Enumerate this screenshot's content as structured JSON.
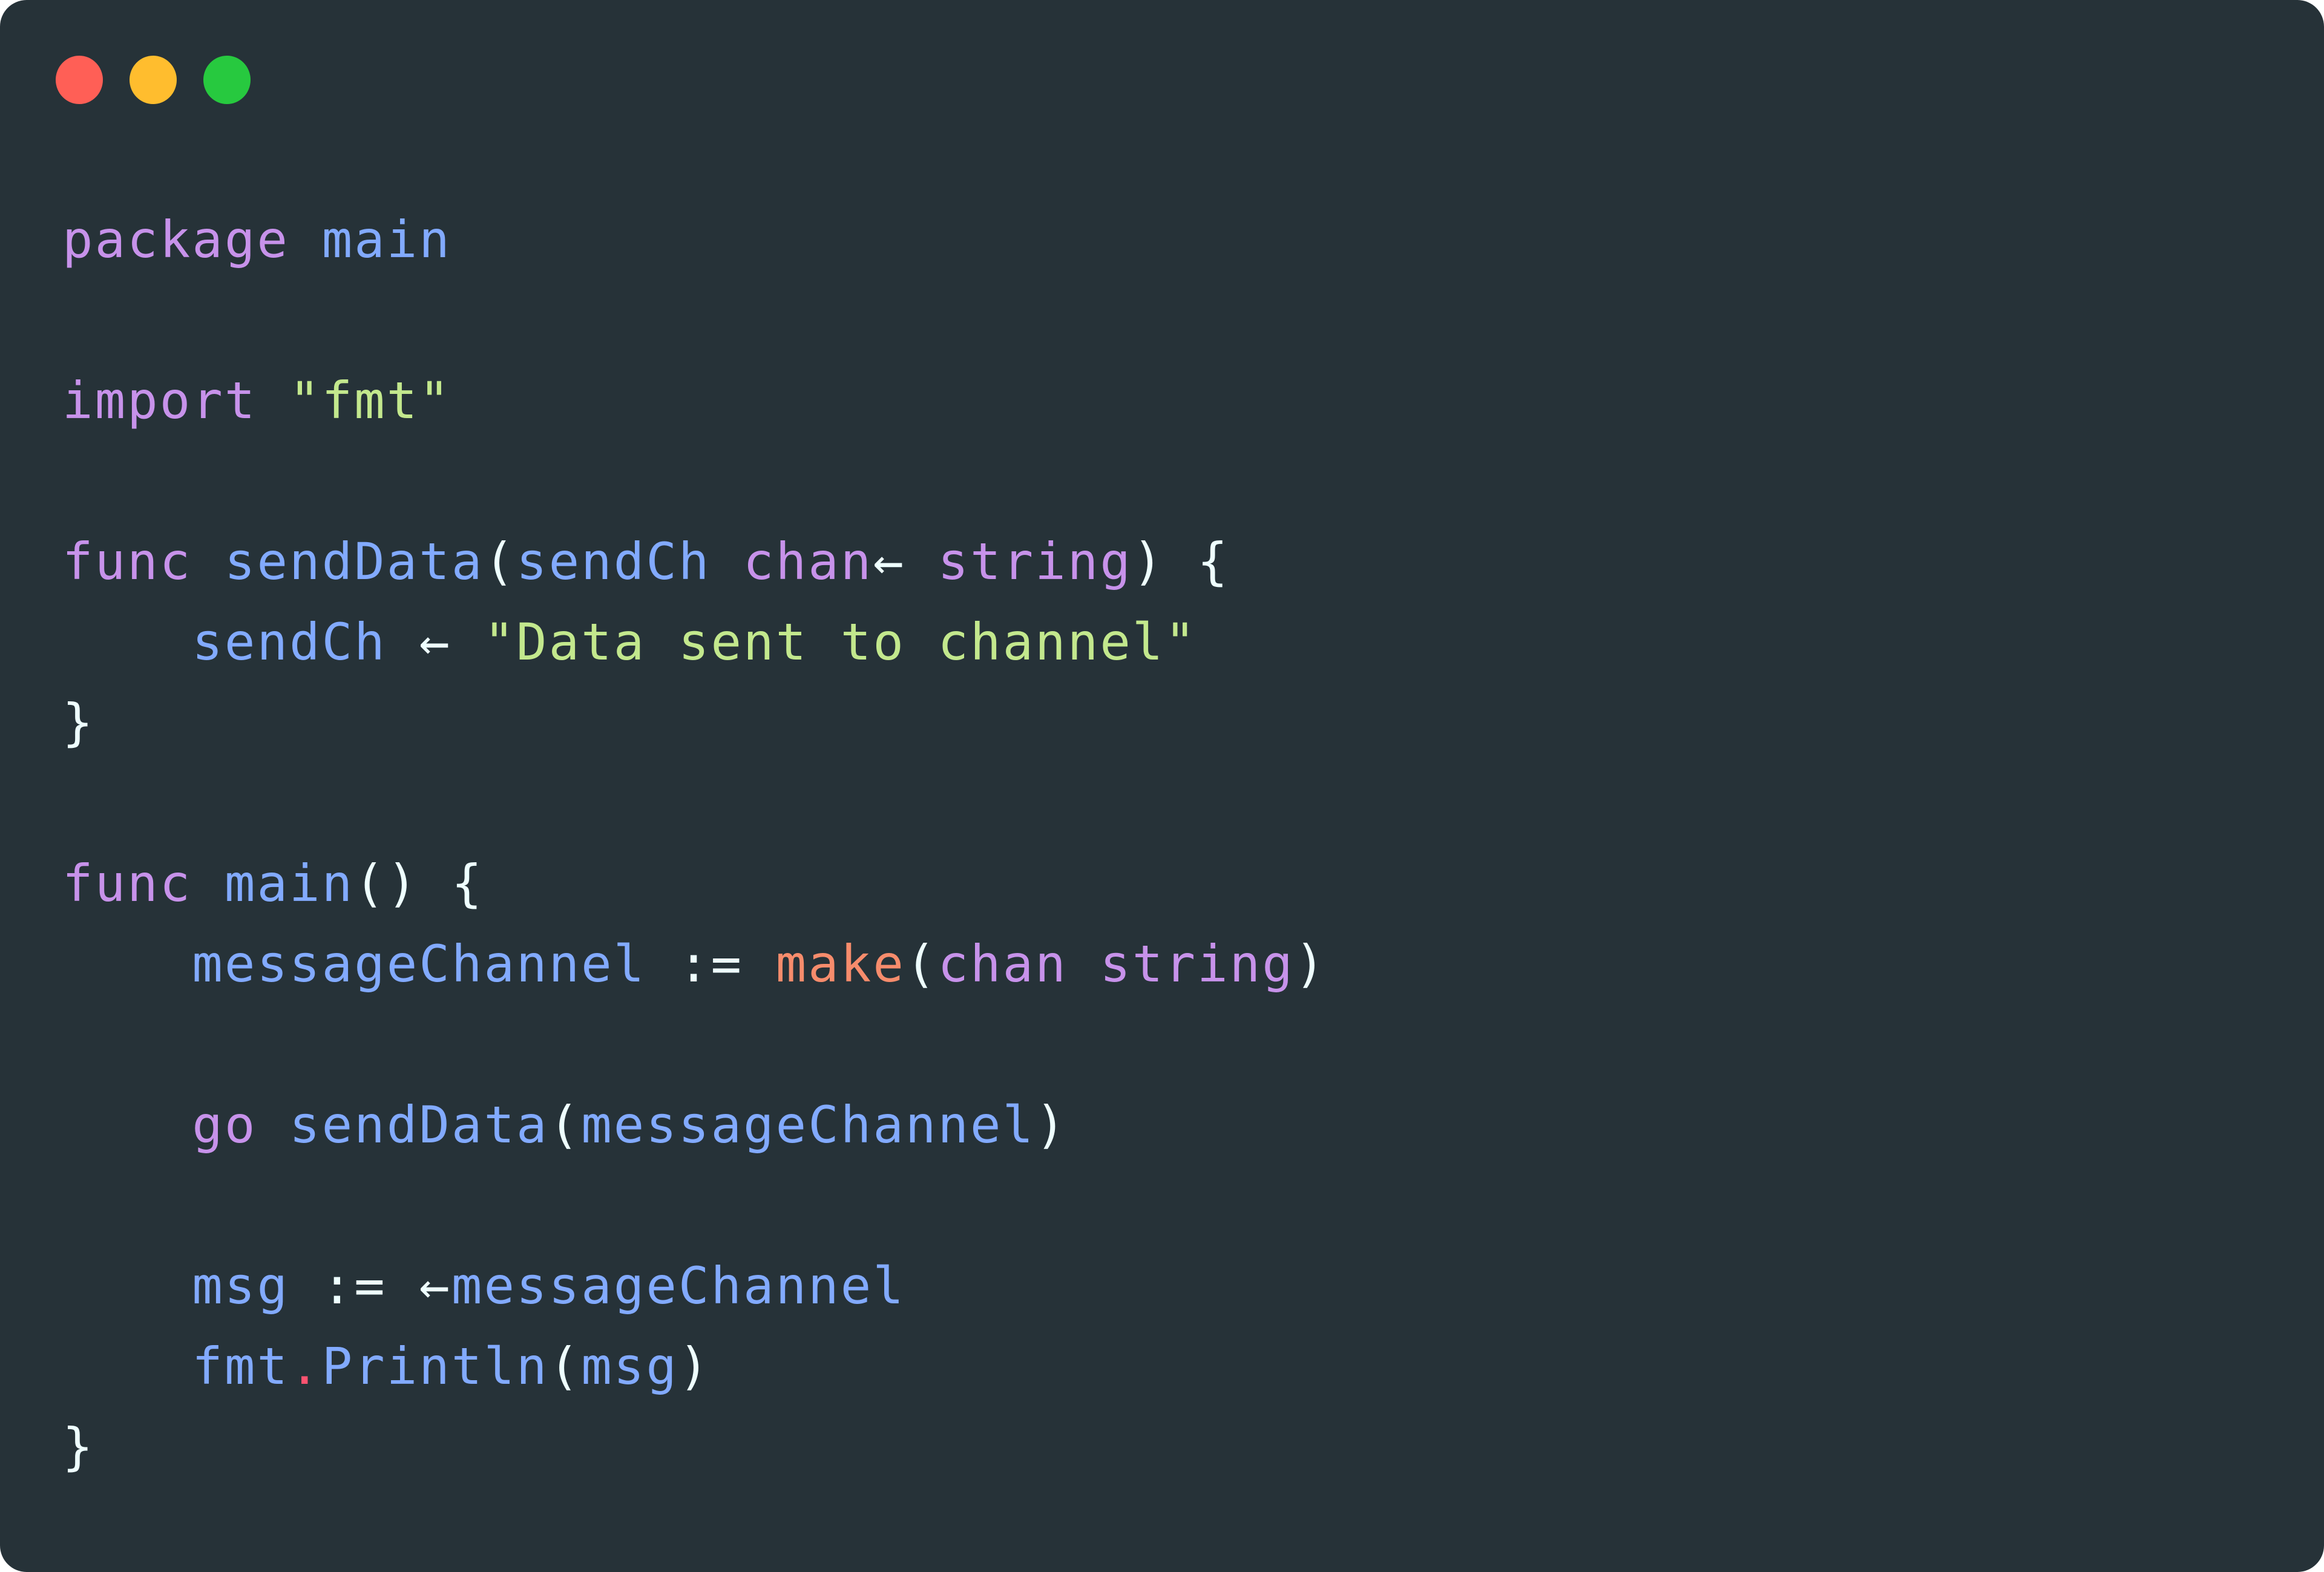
{
  "window": {
    "background": "#263238",
    "controls": [
      {
        "name": "close",
        "color": "#ff5f56"
      },
      {
        "name": "minimize",
        "color": "#ffbd2e"
      },
      {
        "name": "maximize",
        "color": "#27c93f"
      }
    ]
  },
  "language": "go",
  "code": {
    "lines": [
      [
        {
          "t": "package",
          "c": "kw"
        },
        {
          "t": " ",
          "c": "punct"
        },
        {
          "t": "main",
          "c": "id"
        }
      ],
      [],
      [
        {
          "t": "import",
          "c": "kw"
        },
        {
          "t": " ",
          "c": "punct"
        },
        {
          "t": "\"fmt\"",
          "c": "str"
        }
      ],
      [],
      [
        {
          "t": "func",
          "c": "kw"
        },
        {
          "t": " ",
          "c": "punct"
        },
        {
          "t": "sendData",
          "c": "id"
        },
        {
          "t": "(",
          "c": "punct"
        },
        {
          "t": "sendCh",
          "c": "id"
        },
        {
          "t": " ",
          "c": "punct"
        },
        {
          "t": "chan",
          "c": "kw"
        },
        {
          "t": "←",
          "c": "punct"
        },
        {
          "t": " ",
          "c": "punct"
        },
        {
          "t": "string",
          "c": "kw"
        },
        {
          "t": ") {",
          "c": "punct"
        }
      ],
      [
        {
          "t": "    ",
          "c": "punct"
        },
        {
          "t": "sendCh",
          "c": "id"
        },
        {
          "t": " ← ",
          "c": "punct"
        },
        {
          "t": "\"Data sent to channel\"",
          "c": "str"
        }
      ],
      [
        {
          "t": "}",
          "c": "punct"
        }
      ],
      [],
      [
        {
          "t": "func",
          "c": "kw"
        },
        {
          "t": " ",
          "c": "punct"
        },
        {
          "t": "main",
          "c": "id"
        },
        {
          "t": "() {",
          "c": "punct"
        }
      ],
      [
        {
          "t": "    ",
          "c": "punct"
        },
        {
          "t": "messageChannel",
          "c": "id"
        },
        {
          "t": " := ",
          "c": "punct"
        },
        {
          "t": "make",
          "c": "builtin"
        },
        {
          "t": "(",
          "c": "punct"
        },
        {
          "t": "chan",
          "c": "kw"
        },
        {
          "t": " ",
          "c": "punct"
        },
        {
          "t": "string",
          "c": "kw"
        },
        {
          "t": ")",
          "c": "punct"
        }
      ],
      [],
      [
        {
          "t": "    ",
          "c": "punct"
        },
        {
          "t": "go",
          "c": "kw"
        },
        {
          "t": " ",
          "c": "punct"
        },
        {
          "t": "sendData",
          "c": "id"
        },
        {
          "t": "(",
          "c": "punct"
        },
        {
          "t": "messageChannel",
          "c": "id"
        },
        {
          "t": ")",
          "c": "punct"
        }
      ],
      [],
      [
        {
          "t": "    ",
          "c": "punct"
        },
        {
          "t": "msg",
          "c": "id"
        },
        {
          "t": " := ←",
          "c": "punct"
        },
        {
          "t": "messageChannel",
          "c": "id"
        }
      ],
      [
        {
          "t": "    ",
          "c": "punct"
        },
        {
          "t": "fmt",
          "c": "id"
        },
        {
          "t": ".",
          "c": "dot"
        },
        {
          "t": "Println",
          "c": "id"
        },
        {
          "t": "(",
          "c": "punct"
        },
        {
          "t": "msg",
          "c": "id"
        },
        {
          "t": ")",
          "c": "punct"
        }
      ],
      [
        {
          "t": "}",
          "c": "punct"
        }
      ]
    ]
  }
}
